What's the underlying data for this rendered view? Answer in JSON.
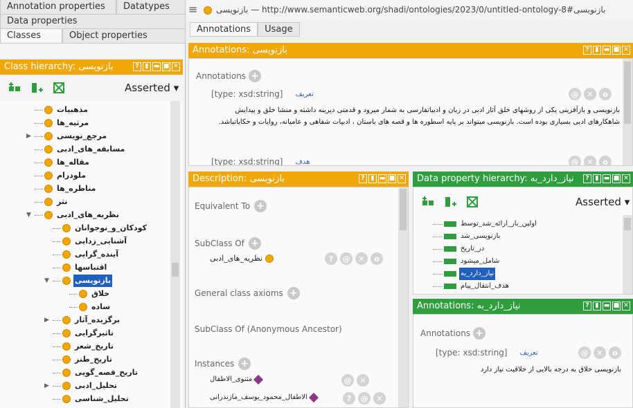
{
  "left": {
    "tabs_row1": [
      "Annotation properties",
      "Datatypes"
    ],
    "tabs_row2": [
      "Data properties"
    ],
    "tabs_row3": [
      "Classes",
      "Object properties"
    ],
    "class_hierarchy_title": "Class hierarchy: بازنویسی",
    "asserted": "Asserted",
    "tree": [
      {
        "label": "مذهبیات",
        "depth": 1,
        "expand": ""
      },
      {
        "label": "مرثیه_ها",
        "depth": 1,
        "expand": ""
      },
      {
        "label": "مرجع_نویسی",
        "depth": 1,
        "expand": "▶"
      },
      {
        "label": "مسابقه_های_ادبی",
        "depth": 1,
        "expand": ""
      },
      {
        "label": "مقاله_ها",
        "depth": 1,
        "expand": ""
      },
      {
        "label": "ملودرام",
        "depth": 1,
        "expand": ""
      },
      {
        "label": "مناظره_ها",
        "depth": 1,
        "expand": ""
      },
      {
        "label": "نثر",
        "depth": 1,
        "expand": ""
      },
      {
        "label": "نظریه_های_ادبی",
        "depth": 1,
        "expand": "▼"
      },
      {
        "label": "کودکان_و_نوجوانان",
        "depth": 2,
        "expand": ""
      },
      {
        "label": "آشنایی_زدایی",
        "depth": 2,
        "expand": ""
      },
      {
        "label": "آینده_گرایی",
        "depth": 2,
        "expand": ""
      },
      {
        "label": "اقتباسها",
        "depth": 2,
        "expand": ""
      },
      {
        "label": "بازنویسی",
        "depth": 2,
        "expand": "▼",
        "selected": true
      },
      {
        "label": "خلاق",
        "depth": 3,
        "expand": ""
      },
      {
        "label": "ساده",
        "depth": 3,
        "expand": ""
      },
      {
        "label": "برگزیده_آثار",
        "depth": 2,
        "expand": "▶"
      },
      {
        "label": "تاثیرگرایی",
        "depth": 2,
        "expand": ""
      },
      {
        "label": "تاریخ_شعر",
        "depth": 2,
        "expand": ""
      },
      {
        "label": "تاریخ_طنز",
        "depth": 2,
        "expand": ""
      },
      {
        "label": "تاریخ_قصه_گویی",
        "depth": 2,
        "expand": ""
      },
      {
        "label": "تحلیل_ادبی",
        "depth": 2,
        "expand": "▶"
      },
      {
        "label": "تحلیل_شناسی",
        "depth": 2,
        "expand": ""
      }
    ]
  },
  "title": {
    "menu_icon": "≡",
    "text": "بازنویسی — http://www.semanticweb.org/shadi/ontologies/2023/0/untitled-ontology-8#بازنویسی"
  },
  "main_tabs": [
    "Annotations",
    "Usage"
  ],
  "annotations_panel": {
    "title": "Annotations: بازنویسی",
    "label": "Annotations",
    "entries": [
      {
        "type": "[type: xsd:string]",
        "link": "تعریف",
        "text": "بازنویسی و بازآفرینی یکی از روشهای خلق آثار ادبی در زبان و ادبیاتفارسی به شمار میرود و قدمتی دیرینه داشته و منشا خلق و پیدایش شاهکارهای ادبی بسیاری بوده است. بازنویسی میتواند بر پایه اسطوره ها و قصه های باستان ، ادبیات شفاهی و عامیانه، روایات و حکایاتباشد."
      },
      {
        "type": "[type: xsd:string]",
        "link": "هدف",
        "text": ""
      }
    ]
  },
  "description_panel": {
    "title": "Description: بازنویسی",
    "equivalent_to": "Equivalent To",
    "subclass_of": "SubClass Of",
    "subclass_value": "نظریه_های_ادبی",
    "general_axioms": "General class axioms",
    "anon_ancestor": "SubClass Of (Anonymous Ancestor)",
    "instances": "Instances",
    "instance_items": [
      "مثنوی_الاطفال",
      "الاطفال_محمود_یوسف_مازندرانی"
    ]
  },
  "data_property_panel": {
    "title": "Data property hierarchy: نیاز_دارد_به",
    "asserted": "Asserted",
    "items": [
      {
        "label": "اولین_بار_ارائه_شد_توسط"
      },
      {
        "label": "بازنویسی_شد"
      },
      {
        "label": "در_تاریخ"
      },
      {
        "label": "شامل_میشود"
      },
      {
        "label": "نیاز_دارد_به",
        "selected": true
      },
      {
        "label": "هدف_انتقال_پیام"
      }
    ]
  },
  "annotations_small_panel": {
    "title": "Annotations: نیاز_دارد_به",
    "label": "Annotations",
    "type": "[type: xsd:string]",
    "link": "تعریف",
    "text": "بازنویسی خلاق به درجه بالایی از خلاقیت نیاز دارد"
  },
  "window_buttons": [
    "?",
    "▮",
    "▬",
    "■",
    "✕"
  ],
  "colors": {
    "orange": "#f0a70a",
    "green": "#2f9e3f",
    "selected": "#1f5fbf"
  }
}
